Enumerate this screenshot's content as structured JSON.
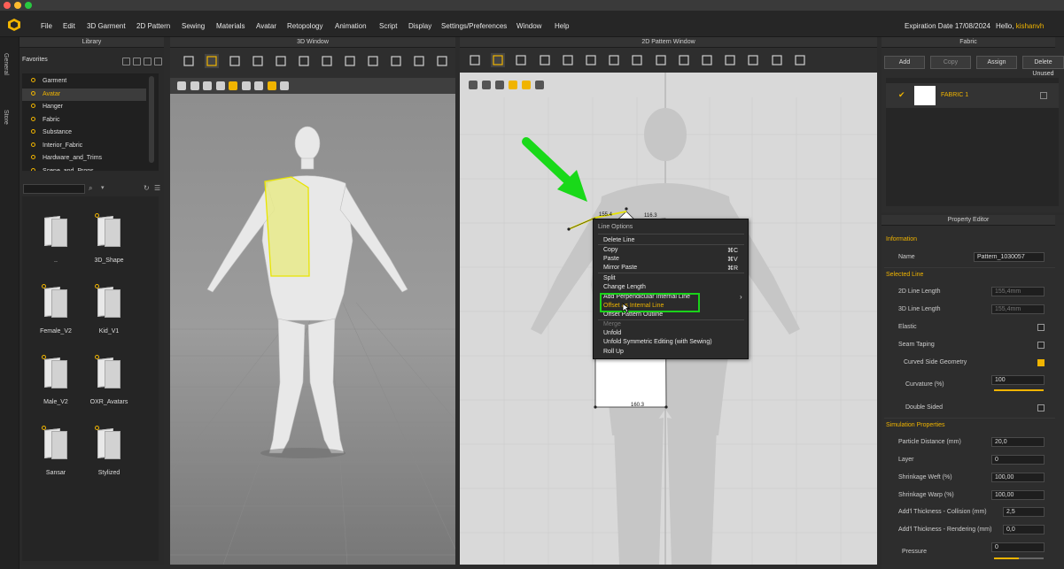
{
  "window_controls": {
    "close_color": "#ff5f57",
    "min_color": "#febc2e",
    "max_color": "#28c840"
  },
  "menu": [
    "File",
    "Edit",
    "3D Garment",
    "2D Pattern",
    "Sewing",
    "Materials",
    "Avatar",
    "Retopology",
    "Animation",
    "Script",
    "Display",
    "Settings/Preferences",
    "Window",
    "Help"
  ],
  "header": {
    "expiration": "Expiration Date 17/08/2024",
    "hello": "Hello,",
    "user": "kishanvh"
  },
  "side_tabs": [
    "General",
    "Store"
  ],
  "library": {
    "title": "Library",
    "favorites": "Favorites",
    "items": [
      "Garment",
      "Avatar",
      "Hanger",
      "Fabric",
      "Substance",
      "Interior_Fabric",
      "Hardware_and_Trims",
      "Scene_and_Props"
    ],
    "selected": "Avatar",
    "folders": [
      "..",
      "3D_Shape",
      "Female_V2",
      "Kid_V1",
      "Male_V2",
      "OXR_Avatars",
      "Sansar",
      "Stylized"
    ]
  },
  "window3d": {
    "title": "3D Window"
  },
  "window2d": {
    "title": "2D Pattern Window",
    "labels": {
      "top_left": "155.4",
      "top_right": "116.3",
      "bottom": "160.3"
    }
  },
  "fabric": {
    "title": "Fabric",
    "buttons": [
      "Add",
      "Copy",
      "Assign",
      "Delete Unused"
    ],
    "items": [
      {
        "name": "FABRIC 1"
      }
    ]
  },
  "property_editor": {
    "title": "Property Editor",
    "sections": {
      "information": "Information",
      "selected_line": "Selected Line",
      "simulation": "Simulation Properties"
    },
    "name_label": "Name",
    "name_value": "Pattern_1030057",
    "line_2d_label": "2D Line Length",
    "line_2d_value": "155,4mm",
    "line_3d_label": "3D Line Length",
    "line_3d_value": "155,4mm",
    "elastic": "Elastic",
    "seam_taping": "Seam Taping",
    "curved": "Curved Side Geometry",
    "curvature_label": "Curvature (%)",
    "curvature_value": "100",
    "double_sided": "Double Sided",
    "particle_label": "Particle Distance (mm)",
    "particle_value": "20,0",
    "layer_label": "Layer",
    "layer_value": "0",
    "weft_label": "Shrinkage Weft (%)",
    "weft_value": "100,00",
    "warp_label": "Shrinkage Warp (%)",
    "warp_value": "100,00",
    "collision_label": "Add'l Thickness - Collision (mm)",
    "collision_value": "2,5",
    "rendering_label": "Add'l Thickness - Rendering (mm)",
    "rendering_value": "0,0",
    "pressure_label": "Pressure",
    "pressure_value": "0",
    "curvature_level": 1.0,
    "pressure_level": 0.5
  },
  "context_menu": {
    "title": "Line Options",
    "items": [
      {
        "label": "Delete Line",
        "shortcut": ""
      },
      {
        "label": "Copy",
        "shortcut": "⌘C"
      },
      {
        "label": "Paste",
        "shortcut": "⌘V"
      },
      {
        "label": "Mirror Paste",
        "shortcut": "⌘R"
      },
      {
        "label": "Split",
        "shortcut": ""
      },
      {
        "label": "Change Length",
        "shortcut": ""
      },
      {
        "label": "Add Perpendicular Internal Line",
        "shortcut": ""
      },
      {
        "label": "Offset as Internal Line",
        "shortcut": ""
      },
      {
        "label": "Offset Pattern Outline",
        "shortcut": ""
      },
      {
        "label": "Merge",
        "shortcut": ""
      },
      {
        "label": "Unfold",
        "shortcut": ""
      },
      {
        "label": "Unfold Symmetric Editing (with Sewing)",
        "shortcut": ""
      },
      {
        "label": "Roll Up",
        "shortcut": ""
      }
    ],
    "highlighted": "Offset as Internal Line",
    "disabled": "Merge",
    "submenu_arrow": "›"
  },
  "colors": {
    "accent": "#f0b400",
    "highlight_box": "#1ad21a",
    "arrow": "#19d919"
  }
}
